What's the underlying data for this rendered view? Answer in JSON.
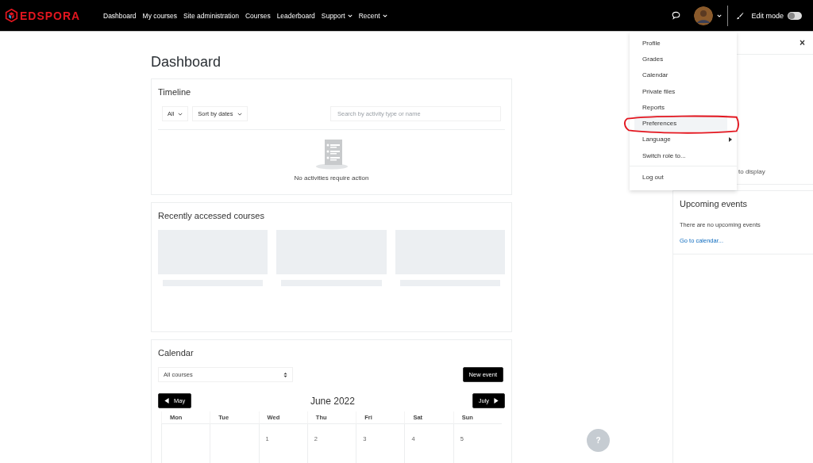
{
  "navbar": {
    "logo": "EDSPORA",
    "links": [
      {
        "label": "Dashboard",
        "dropdown": false
      },
      {
        "label": "My courses",
        "dropdown": false
      },
      {
        "label": "Site administration",
        "dropdown": false
      },
      {
        "label": "Courses",
        "dropdown": false
      },
      {
        "label": "Leaderboard",
        "dropdown": false
      },
      {
        "label": "Support",
        "dropdown": true
      },
      {
        "label": "Recent",
        "dropdown": true
      }
    ],
    "edit_mode": {
      "label": "Edit mode",
      "on": false
    }
  },
  "page_title": "Dashboard",
  "timeline": {
    "title": "Timeline",
    "filter": "All",
    "sort": "Sort by dates",
    "search": {
      "placeholder": "Search by activity type or name"
    },
    "empty_text": "No activities require action"
  },
  "recent_courses": {
    "title": "Recently accessed courses"
  },
  "calendar": {
    "title": "Calendar",
    "course_select": "All courses",
    "new_event": "New event",
    "prev": "May",
    "month": "June 2022",
    "next": "July",
    "weekdays": [
      "Mon",
      "Tue",
      "Wed",
      "Thu",
      "Fri",
      "Sat",
      "Sun"
    ],
    "week": [
      {
        "kind": "blank"
      },
      {
        "kind": "blank"
      },
      {
        "kind": "day",
        "label": "1"
      },
      {
        "kind": "day",
        "label": "2"
      },
      {
        "kind": "day",
        "label": "3"
      },
      {
        "kind": "day",
        "label": "4"
      },
      {
        "kind": "day",
        "label": "5"
      }
    ]
  },
  "user_menu": {
    "items": [
      {
        "label": "Profile",
        "selected": false,
        "kind": "item"
      },
      {
        "label": "Grades",
        "selected": false,
        "kind": "item"
      },
      {
        "label": "Calendar",
        "selected": false,
        "kind": "item"
      },
      {
        "label": "Private files",
        "selected": false,
        "kind": "item"
      },
      {
        "label": "Reports",
        "selected": false,
        "kind": "item"
      },
      {
        "label": "Preferences",
        "selected": true,
        "kind": "item"
      },
      {
        "label": "Language",
        "selected": false,
        "kind": "submenu"
      },
      {
        "label": "Switch role to...",
        "selected": false,
        "kind": "item"
      },
      {
        "label": "Log out",
        "selected": false,
        "kind": "separated"
      }
    ]
  },
  "drawer": {
    "close": "×",
    "hidden_block_text": "to display",
    "upcoming": {
      "title": "Upcoming events",
      "text": "There are no upcoming events",
      "link": "Go to calendar..."
    }
  },
  "help_button": "?"
}
